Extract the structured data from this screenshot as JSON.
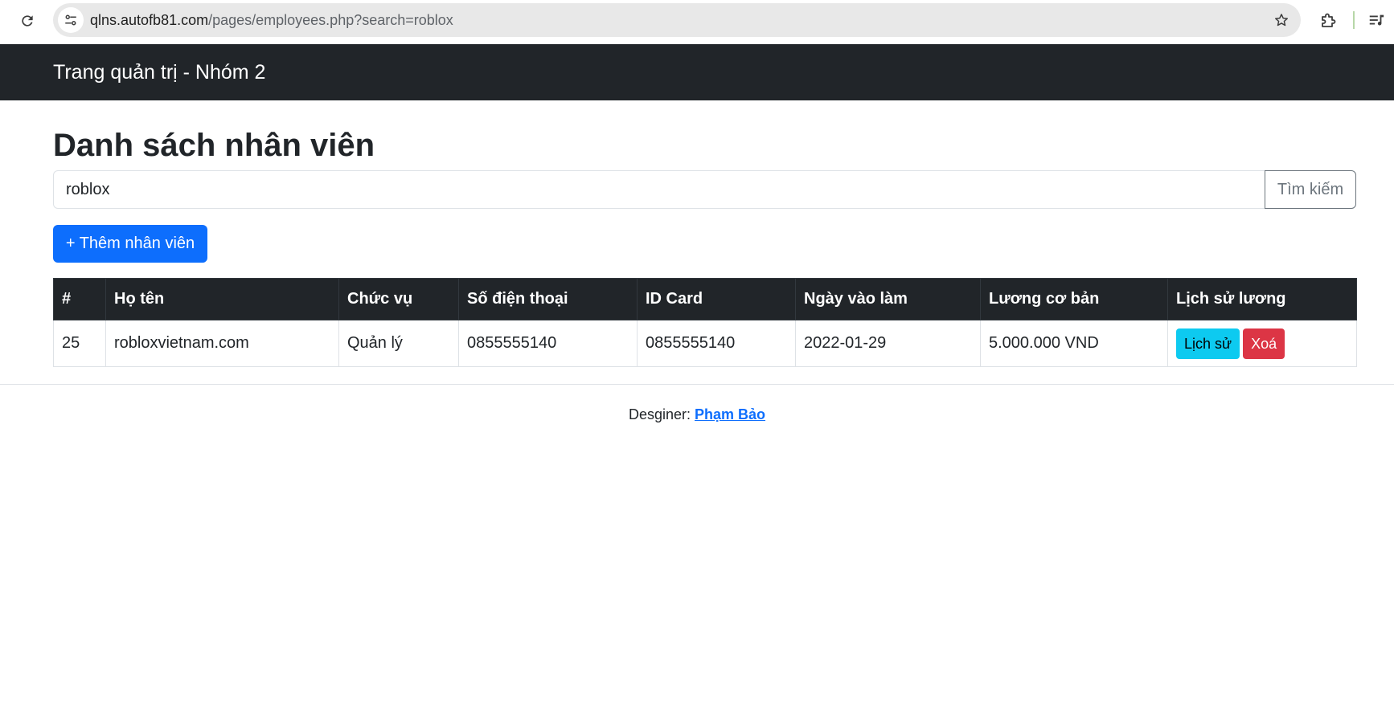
{
  "browser": {
    "url_host": "qlns.autofb81.com",
    "url_path": "/pages/employees.php?search=roblox"
  },
  "navbar": {
    "brand": "Trang quản trị - Nhóm 2"
  },
  "main": {
    "title": "Danh sách nhân viên",
    "search": {
      "value": "roblox",
      "button_label": "Tìm kiếm"
    },
    "add_button_label": "+ Thêm nhân viên"
  },
  "table": {
    "columns": [
      "#",
      "Họ tên",
      "Chức vụ",
      "Số điện thoại",
      "ID Card",
      "Ngày vào làm",
      "Lương cơ bản",
      "Lịch sử lương"
    ],
    "rows": [
      {
        "id": "25",
        "name": "robloxvietnam.com",
        "position": "Quản lý",
        "phone": "0855555140",
        "id_card": "0855555140",
        "start_date": "2022-01-29",
        "salary": "5.000.000 VND",
        "history_label": "Lịch sử",
        "delete_label": "Xoá"
      }
    ]
  },
  "footer": {
    "prefix": "Desginer:",
    "designer_link": "Phạm Bảo"
  },
  "colors": {
    "navbar_bg": "#212529",
    "primary": "#0d6efd",
    "info": "#0dcaf0",
    "danger": "#dc3545"
  },
  "icons": {
    "reload": "reload-icon",
    "site_info": "tune-icon",
    "bookmark": "star-icon",
    "extensions": "puzzle-icon",
    "media": "playlist-icon"
  }
}
